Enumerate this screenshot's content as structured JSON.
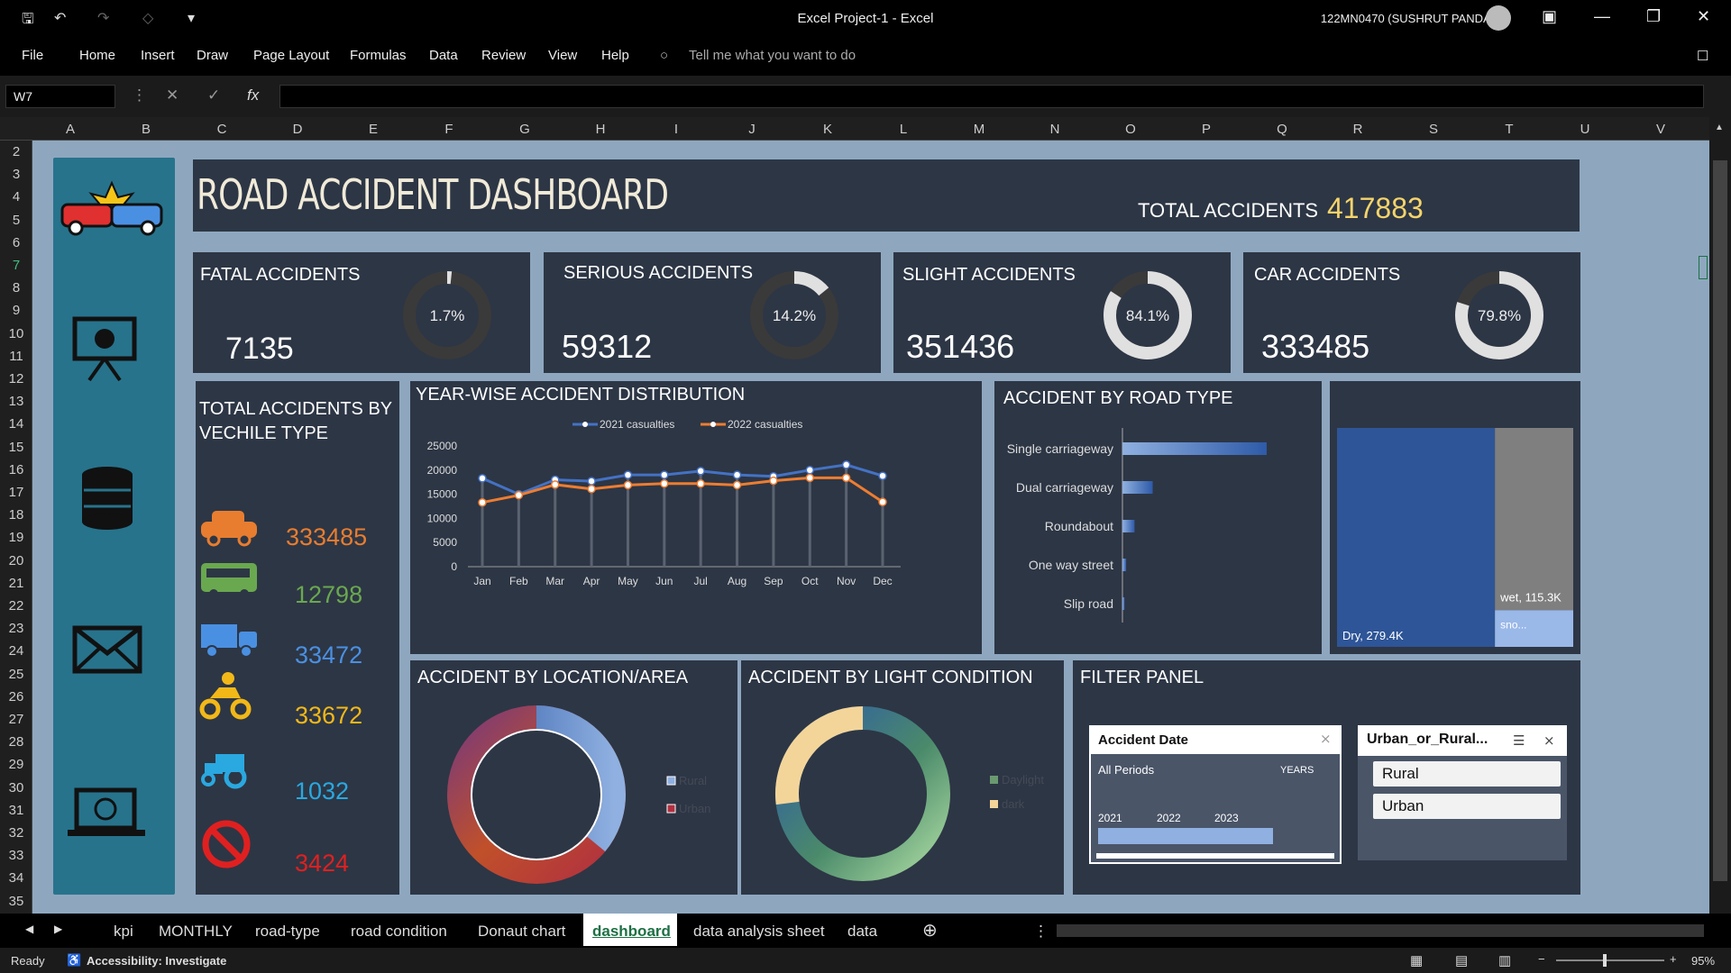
{
  "window": {
    "title": "Excel Project-1  -  Excel",
    "user": "122MN0470 (SUSHRUT PANDA)"
  },
  "menu": [
    "File",
    "Home",
    "Insert",
    "Draw",
    "Page Layout",
    "Formulas",
    "Data",
    "Review",
    "View",
    "Help"
  ],
  "tell_me": "Tell me what you want to do",
  "namebox": "W7",
  "columns": [
    "A",
    "B",
    "C",
    "D",
    "E",
    "F",
    "G",
    "H",
    "I",
    "J",
    "K",
    "L",
    "M",
    "N",
    "O",
    "P",
    "Q",
    "R",
    "S",
    "T",
    "U",
    "V"
  ],
  "rows": [
    "2",
    "3",
    "4",
    "5",
    "6",
    "7",
    "8",
    "9",
    "10",
    "11",
    "12",
    "13",
    "14",
    "15",
    "16",
    "17",
    "18",
    "19",
    "20",
    "21",
    "22",
    "23",
    "24",
    "25",
    "26",
    "27",
    "28",
    "29",
    "30",
    "31",
    "32",
    "33",
    "34",
    "35"
  ],
  "dashboard": {
    "title": "ROAD ACCIDENT DASHBOARD",
    "total_label": "TOTAL ACCIDENTS",
    "total_value": "417883"
  },
  "kpis": [
    {
      "label": "FATAL ACCIDENTS",
      "value": "7135",
      "pct_label": "1.7%",
      "pct": 0.017
    },
    {
      "label": "SERIOUS ACCIDENTS",
      "value": "59312",
      "pct_label": "14.2%",
      "pct": 0.142
    },
    {
      "label": "SLIGHT ACCIDENTS",
      "value": "351436",
      "pct_label": "84.1%",
      "pct": 0.841
    },
    {
      "label": "CAR ACCIDENTS",
      "value": "333485",
      "pct_label": "79.8%",
      "pct": 0.798
    }
  ],
  "vehicle": {
    "title": "TOTAL ACCIDENTS BY VECHILE TYPE",
    "items": [
      {
        "icon": "car-icon",
        "value": "333485",
        "color": "#e87d2f"
      },
      {
        "icon": "bus-icon",
        "value": "12798",
        "color": "#6aa84f"
      },
      {
        "icon": "truck-icon",
        "value": "33472",
        "color": "#4a90e2"
      },
      {
        "icon": "motorbike-icon",
        "value": "33672",
        "color": "#f2b818"
      },
      {
        "icon": "tractor-icon",
        "value": "1032",
        "color": "#2aa8e0"
      },
      {
        "icon": "no-entry-icon",
        "value": "3424",
        "color": "#e02020"
      }
    ]
  },
  "chart_data": [
    {
      "type": "line",
      "title": "YEAR-WISE ACCIDENT DISTRIBUTION",
      "categories": [
        "Jan",
        "Feb",
        "Mar",
        "Apr",
        "May",
        "Jun",
        "Jul",
        "Aug",
        "Sep",
        "Oct",
        "Nov",
        "Dec"
      ],
      "series": [
        {
          "name": "2021 casualties",
          "color": "#4472c4",
          "values": [
            18300,
            15000,
            18000,
            17700,
            19000,
            19000,
            19800,
            19000,
            18700,
            20000,
            21100,
            18800
          ]
        },
        {
          "name": "2022 casualties",
          "color": "#ed7d31",
          "values": [
            13300,
            14800,
            17000,
            16100,
            16900,
            17200,
            17200,
            16900,
            17800,
            18400,
            18400,
            13400
          ]
        }
      ],
      "yticks": [
        "25000",
        "20000",
        "15000",
        "10000",
        "5000",
        "0"
      ],
      "ylim": [
        0,
        25000
      ],
      "grid": false,
      "legend": "top"
    },
    {
      "type": "bar",
      "title": "ACCIDENT BY ROAD TYPE",
      "categories": [
        "Single carriageway",
        "Dual carriageway",
        "Roundabout",
        "One way street",
        "Slip road"
      ],
      "values": [
        310000,
        65000,
        26000,
        8000,
        4500
      ]
    },
    {
      "type": "treemap",
      "categories": [
        "Dry",
        "wet",
        "sno..."
      ],
      "labels": [
        "Dry, 279.4K",
        "wet, 115.3K",
        "sno..."
      ],
      "values": [
        279.4,
        115.3,
        23.2
      ]
    },
    {
      "type": "pie",
      "title": "ACCIDENT BY LOCATION/AREA",
      "categories": [
        "Rural",
        "Urban"
      ],
      "values": [
        36,
        64
      ]
    },
    {
      "type": "pie",
      "title": "ACCIDENT BY LIGHT CONDITION",
      "categories": [
        "Daylight",
        "dark"
      ],
      "values": [
        73,
        27
      ]
    }
  ],
  "filter": {
    "title": "FILTER PANEL",
    "date_title": "Accident Date",
    "periods": "All Periods",
    "years_label": "YEARS",
    "years": [
      "2021",
      "2022",
      "2023"
    ],
    "area_title": "Urban_or_Rural...",
    "area_items": [
      "Rural",
      "Urban"
    ]
  },
  "sheet_tabs": [
    "kpi",
    "MONTHLY",
    "road-type",
    "road condition",
    "Donaut chart",
    "dashboard",
    "data analysis sheet",
    "data"
  ],
  "status": {
    "ready": "Ready",
    "accessibility": "Accessibility: Investigate",
    "zoom": "95%"
  }
}
